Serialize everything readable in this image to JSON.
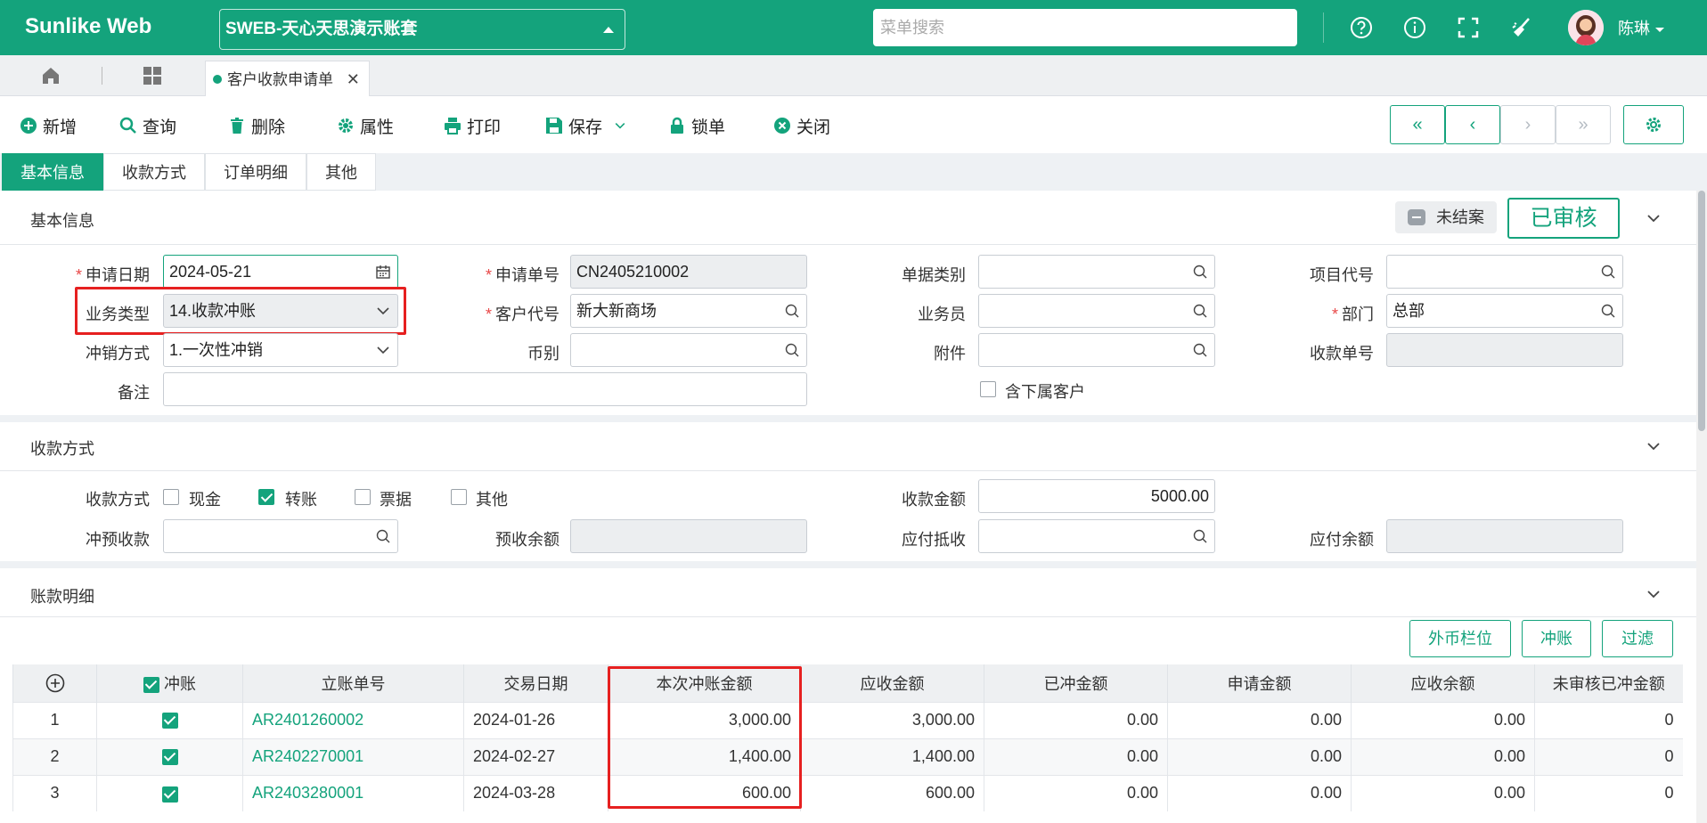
{
  "app": {
    "title": "Sunlike Web",
    "account": "SWEB-天心天思演示账套",
    "search_placeholder": "菜单搜索",
    "user": "陈琳"
  },
  "doc_tab": {
    "label": "客户收款申请单"
  },
  "toolbar": {
    "add": "新增",
    "query": "查询",
    "delete": "删除",
    "props": "属性",
    "print": "打印",
    "save": "保存",
    "lock": "锁单",
    "close": "关闭"
  },
  "page_tabs": [
    "基本信息",
    "收款方式",
    "订单明细",
    "其他"
  ],
  "basic": {
    "title": "基本信息",
    "status": "未结案",
    "stamp": "已审核",
    "labels": {
      "apply_date": "申请日期",
      "apply_no": "申请单号",
      "doc_type": "单据类别",
      "project": "项目代号",
      "biz_type": "业务类型",
      "customer": "客户代号",
      "salesman": "业务员",
      "dept": "部门",
      "offset_method": "冲销方式",
      "currency": "币别",
      "attachment": "附件",
      "receipt_no": "收款单号",
      "remark": "备注",
      "include_sub": "含下属客户"
    },
    "values": {
      "apply_date": "2024-05-21",
      "apply_no": "CN2405210002",
      "biz_type": "14.收款冲账",
      "customer": "新大新商场",
      "dept": "总部",
      "offset_method": "1.一次性冲销"
    }
  },
  "payment": {
    "title": "收款方式",
    "labels": {
      "method": "收款方式",
      "amount": "收款金额",
      "offset_pre": "冲预收款",
      "pre_balance": "预收余额",
      "payable_offset": "应付抵收",
      "payable_balance": "应付余额"
    },
    "options": [
      "现金",
      "转账",
      "票据",
      "其他"
    ],
    "amount": "5000.00"
  },
  "detail": {
    "title": "账款明细",
    "buttons": {
      "foreign": "外币栏位",
      "offset": "冲账",
      "filter": "过滤"
    },
    "columns": {
      "offset": "冲账",
      "doc_no": "立账单号",
      "date": "交易日期",
      "this_amount": "本次冲账金额",
      "receivable": "应收金额",
      "offsetted": "已冲金额",
      "applied": "申请金额",
      "balance": "应收余额",
      "unaudited": "未审核已冲金额"
    },
    "rows": [
      {
        "idx": "1",
        "doc_no": "AR2401260002",
        "date": "2024-01-26",
        "this_amount": "3,000.00",
        "receivable": "3,000.00",
        "offsetted": "0.00",
        "applied": "0.00",
        "balance": "0.00",
        "unaudited": "0"
      },
      {
        "idx": "2",
        "doc_no": "AR2402270001",
        "date": "2024-02-27",
        "this_amount": "1,400.00",
        "receivable": "1,400.00",
        "offsetted": "0.00",
        "applied": "0.00",
        "balance": "0.00",
        "unaudited": "0"
      },
      {
        "idx": "3",
        "doc_no": "AR2403280001",
        "date": "2024-03-28",
        "this_amount": "600.00",
        "receivable": "600.00",
        "offsetted": "0.00",
        "applied": "0.00",
        "balance": "0.00",
        "unaudited": "0"
      }
    ]
  },
  "colors": {
    "brand": "#14a37c",
    "highlight": "#e62020"
  }
}
